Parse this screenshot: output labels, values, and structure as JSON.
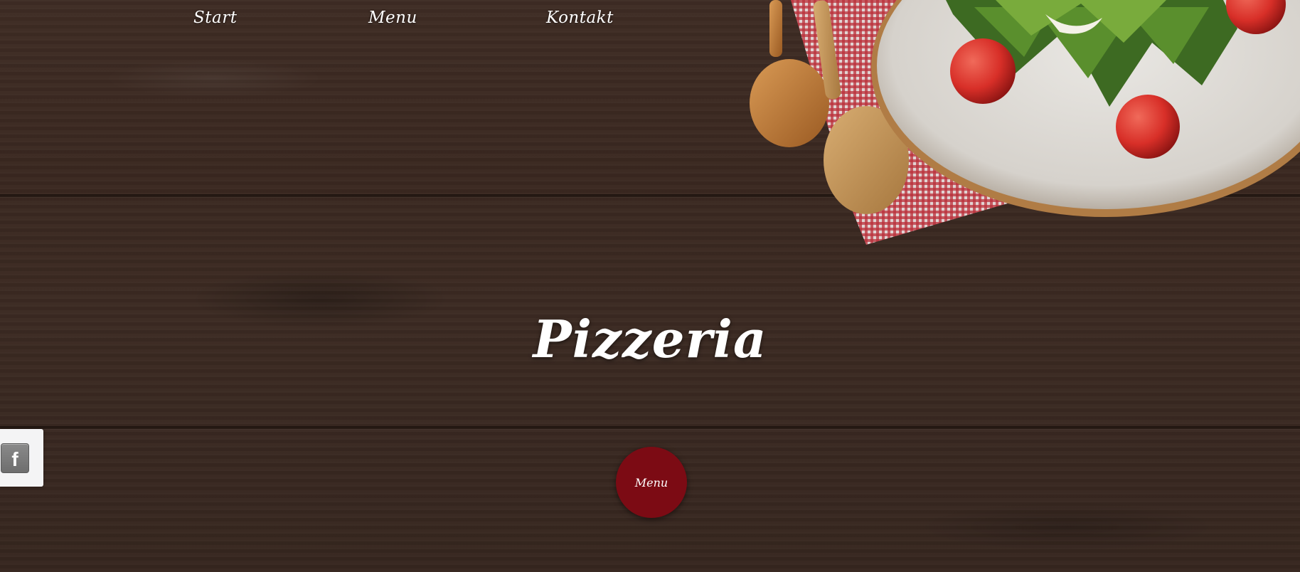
{
  "nav": {
    "items": [
      {
        "label": "Start"
      },
      {
        "label": "Menu"
      },
      {
        "label": "Kontakt"
      }
    ]
  },
  "hero": {
    "title": "Pizzeria",
    "menu_button_label": "Menu"
  },
  "social": {
    "facebook_letter": "f"
  },
  "colors": {
    "wood": "#3a2922",
    "accent_red": "#7c0b14",
    "text": "#ffffff",
    "facebook_tab_bg": "#f4f4f5"
  },
  "icons": [
    "facebook-icon"
  ],
  "decor": {
    "background": "wooden-table",
    "image": "salad-plate-with-wooden-spoons-on-checkered-napkin"
  }
}
